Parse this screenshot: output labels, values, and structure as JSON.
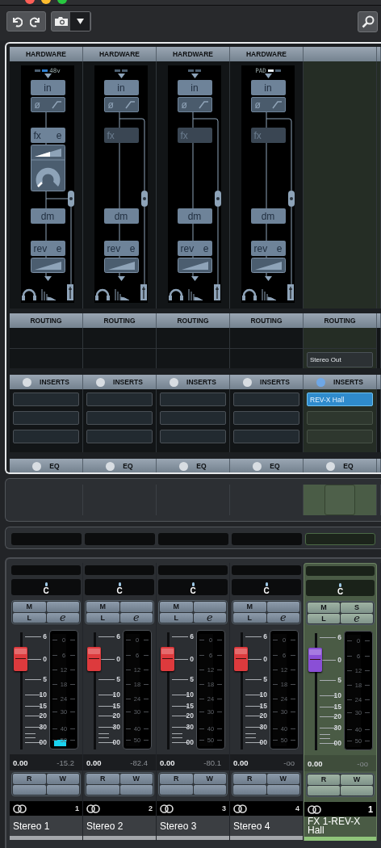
{
  "channels": [
    {
      "kind": "audio",
      "number": "1",
      "name": "Stereo 1",
      "color": "#a4a7ab",
      "hardware": {
        "header": "HARDWARE",
        "kind": "phantom",
        "tag": "48v",
        "leds": [
          false,
          true
        ],
        "input": "in",
        "phase": "ø",
        "fx": "fx",
        "fx_edit": "e",
        "fx_active": true,
        "dm": "dm",
        "rev": "rev",
        "rev_edit": "e"
      },
      "routing": {
        "header": "ROUTING"
      },
      "inserts": {
        "header": "INSERTS",
        "on": false
      },
      "eq": {
        "header": "EQ",
        "on": false
      },
      "pan": "C",
      "buttons_top": [
        "M"
      ],
      "buttons_bottom": [
        "L",
        "e"
      ],
      "rw": [
        "R",
        "W"
      ],
      "fader": {
        "color": "#dd3a3d",
        "level": 0.77,
        "value": "0.00",
        "scale": [
          "6",
          "0",
          "5",
          "10",
          "15",
          "20",
          "30",
          "00"
        ]
      },
      "meter": {
        "level": 0.06,
        "reading": "-15.2",
        "scale": [
          "0",
          "6",
          "12",
          "18",
          "24",
          "30",
          "40",
          "50"
        ]
      }
    },
    {
      "kind": "audio",
      "number": "2",
      "name": "Stereo 2",
      "color": "#a4a7ab",
      "hardware": {
        "header": "HARDWARE",
        "kind": "plain",
        "leds": [
          false,
          false
        ],
        "input": "in",
        "phase": "ø",
        "fx": "fx",
        "fx_active": false,
        "dm": "dm",
        "rev": "rev",
        "rev_edit": "e"
      },
      "routing": {
        "header": "ROUTING"
      },
      "inserts": {
        "header": "INSERTS",
        "on": false
      },
      "eq": {
        "header": "EQ",
        "on": false
      },
      "pan": "C",
      "buttons_top": [
        "M"
      ],
      "buttons_bottom": [
        "L",
        "e"
      ],
      "rw": [
        "R",
        "W"
      ],
      "fader": {
        "color": "#dd3a3d",
        "level": 0.77,
        "value": "0.00",
        "scale": [
          "6",
          "0",
          "5",
          "10",
          "15",
          "20",
          "30",
          "00"
        ]
      },
      "meter": {
        "reading": "-82.4",
        "scale": [
          "0",
          "6",
          "12",
          "18",
          "24",
          "30",
          "40",
          "50"
        ]
      }
    },
    {
      "kind": "audio",
      "number": "3",
      "name": "Stereo 3",
      "color": "#a4a7ab",
      "hardware": {
        "header": "HARDWARE",
        "kind": "plain",
        "leds": [
          false,
          false
        ],
        "input": "in",
        "phase": "ø",
        "fx": "fx",
        "fx_active": false,
        "dm": "dm",
        "rev": "rev",
        "rev_edit": "e"
      },
      "routing": {
        "header": "ROUTING"
      },
      "inserts": {
        "header": "INSERTS",
        "on": false
      },
      "eq": {
        "header": "EQ",
        "on": false
      },
      "pan": "C",
      "buttons_top": [
        "M"
      ],
      "buttons_bottom": [
        "L",
        "e"
      ],
      "rw": [
        "R",
        "W"
      ],
      "fader": {
        "color": "#dd3a3d",
        "level": 0.77,
        "value": "0.00",
        "scale": [
          "6",
          "0",
          "5",
          "10",
          "15",
          "20",
          "30",
          "00"
        ]
      },
      "meter": {
        "reading": "-80.1",
        "scale": [
          "0",
          "6",
          "12",
          "18",
          "24",
          "30",
          "40",
          "50"
        ]
      }
    },
    {
      "kind": "audio",
      "number": "4",
      "name": "Stereo 4",
      "color": "#a4a7ab",
      "hardware": {
        "header": "HARDWARE",
        "kind": "pad",
        "tag": "PAD",
        "leds": [
          true,
          false
        ],
        "input": "in",
        "phase": "ø",
        "fx": "fx",
        "fx_active": false,
        "dm": "dm",
        "rev": "rev",
        "rev_edit": "e"
      },
      "routing": {
        "header": "ROUTING"
      },
      "inserts": {
        "header": "INSERTS",
        "on": false
      },
      "eq": {
        "header": "EQ",
        "on": false
      },
      "pan": "C",
      "buttons_top": [
        "M"
      ],
      "buttons_bottom": [
        "L",
        "e"
      ],
      "rw": [
        "R",
        "W"
      ],
      "fader": {
        "color": "#dd3a3d",
        "level": 0.77,
        "value": "0.00",
        "scale": [
          "6",
          "0",
          "5",
          "10",
          "15",
          "20",
          "30",
          "00"
        ]
      },
      "meter": {
        "reading": "-oo",
        "scale": [
          "0",
          "6",
          "12",
          "18",
          "24",
          "30",
          "40",
          "50"
        ]
      }
    },
    {
      "kind": "fx",
      "number": "1",
      "name": "FX 1-REV-X Hall",
      "color": "#8fc47a",
      "routing": {
        "header": "ROUTING",
        "output": "Stereo Out"
      },
      "inserts": {
        "header": "INSERTS",
        "on": true,
        "slots": [
          "REV-X Hall"
        ]
      },
      "eq": {
        "header": "EQ",
        "on": false
      },
      "pan": "C",
      "buttons_top": [
        "M",
        "S"
      ],
      "buttons_bottom": [
        "L",
        "e"
      ],
      "rw": [
        "R",
        "W"
      ],
      "fader": {
        "color": "#8a4fd6",
        "level": 0.77,
        "value": "0.00",
        "scale": [
          "6",
          "0",
          "5",
          "10",
          "15",
          "20",
          "30",
          "00"
        ]
      },
      "meter": {
        "reading": "-oo",
        "scale": [
          "0",
          "6",
          "12",
          "18",
          "24",
          "30",
          "40",
          "50"
        ]
      }
    }
  ]
}
